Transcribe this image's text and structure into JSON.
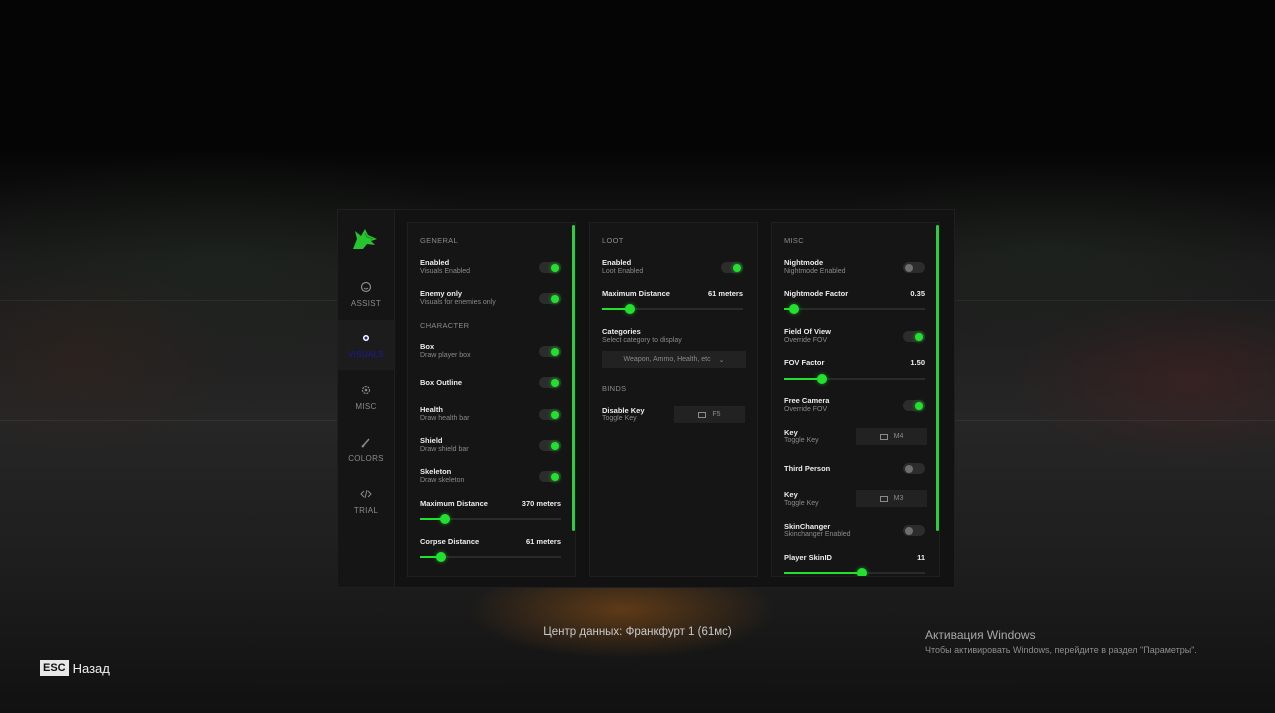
{
  "sidebar": {
    "logo_icon": "wolf-logo-icon",
    "items": [
      {
        "label": "ASSIST",
        "icon": "target-icon"
      },
      {
        "label": "VISUALS",
        "icon": "eye-icon"
      },
      {
        "label": "MISC",
        "icon": "gear-icon"
      },
      {
        "label": "COLORS",
        "icon": "brush-icon"
      },
      {
        "label": "TRIAL",
        "icon": "code-icon"
      }
    ]
  },
  "visuals": {
    "general_header": "GENERAL",
    "enabled": {
      "title": "Enabled",
      "subtitle": "Visuals Enabled",
      "on": true
    },
    "enemy_only": {
      "title": "Enemy only",
      "subtitle": "Visuals for enemies only",
      "on": true
    },
    "character_header": "CHARACTER",
    "box": {
      "title": "Box",
      "subtitle": "Draw player box",
      "on": true
    },
    "box_outline": {
      "title": "Box Outline",
      "on": true
    },
    "health": {
      "title": "Health",
      "subtitle": "Draw health bar",
      "on": true
    },
    "shield": {
      "title": "Shield",
      "subtitle": "Draw shield bar",
      "on": true
    },
    "skeleton": {
      "title": "Skeleton",
      "subtitle": "Draw skeleton",
      "on": true
    },
    "max_distance": {
      "title": "Maximum Distance",
      "value": "370 meters",
      "fraction": 0.18
    },
    "corpse_distance": {
      "title": "Corpse Distance",
      "value": "61 meters",
      "fraction": 0.15
    }
  },
  "loot": {
    "header": "LOOT",
    "enabled": {
      "title": "Enabled",
      "subtitle": "Loot Enabled",
      "on": true
    },
    "max_distance": {
      "title": "Maximum Distance",
      "value": "61 meters",
      "fraction": 0.2
    },
    "categories": {
      "title": "Categories",
      "subtitle": "Select category to display",
      "selected": "Weapon, Ammo, Health, etc"
    },
    "binds_header": "BINDS",
    "disable_key": {
      "title": "Disable Key",
      "subtitle": "Toggle Key",
      "key": "F5"
    }
  },
  "misc": {
    "header": "MISC",
    "nightmode": {
      "title": "Nightmode",
      "subtitle": "Nightmode Enabled",
      "on": false
    },
    "nightmode_factor": {
      "title": "Nightmode Factor",
      "value": "0.35",
      "fraction": 0.07
    },
    "fov": {
      "title": "Field Of View",
      "subtitle": "Override FOV",
      "on": true
    },
    "fov_factor": {
      "title": "FOV Factor",
      "value": "1.50",
      "fraction": 0.27
    },
    "free_camera": {
      "title": "Free Camera",
      "subtitle": "Override FOV",
      "on": true
    },
    "free_camera_key": {
      "title": "Key",
      "subtitle": "Toggle Key",
      "key": "M4"
    },
    "third_person": {
      "title": "Third Person",
      "on": false
    },
    "third_person_key": {
      "title": "Key",
      "subtitle": "Toggle Key",
      "key": "M3"
    },
    "skinchanger": {
      "title": "SkinChanger",
      "subtitle": "Skinchanger Enabled",
      "on": false
    },
    "player_skin": {
      "title": "Player SkinID",
      "value": "11",
      "fraction": 0.55
    }
  },
  "footer": {
    "datacenter": "Центр данных: Франкфурт 1 (61мс)",
    "esc_key": "ESC",
    "back_label": "Назад",
    "windows_title": "Активация Windows",
    "windows_sub": "Чтобы активировать Windows, перейдите в раздел \"Параметры\"."
  },
  "colors": {
    "accent": "#22e02e",
    "active_nav": "#1a1aa8"
  }
}
